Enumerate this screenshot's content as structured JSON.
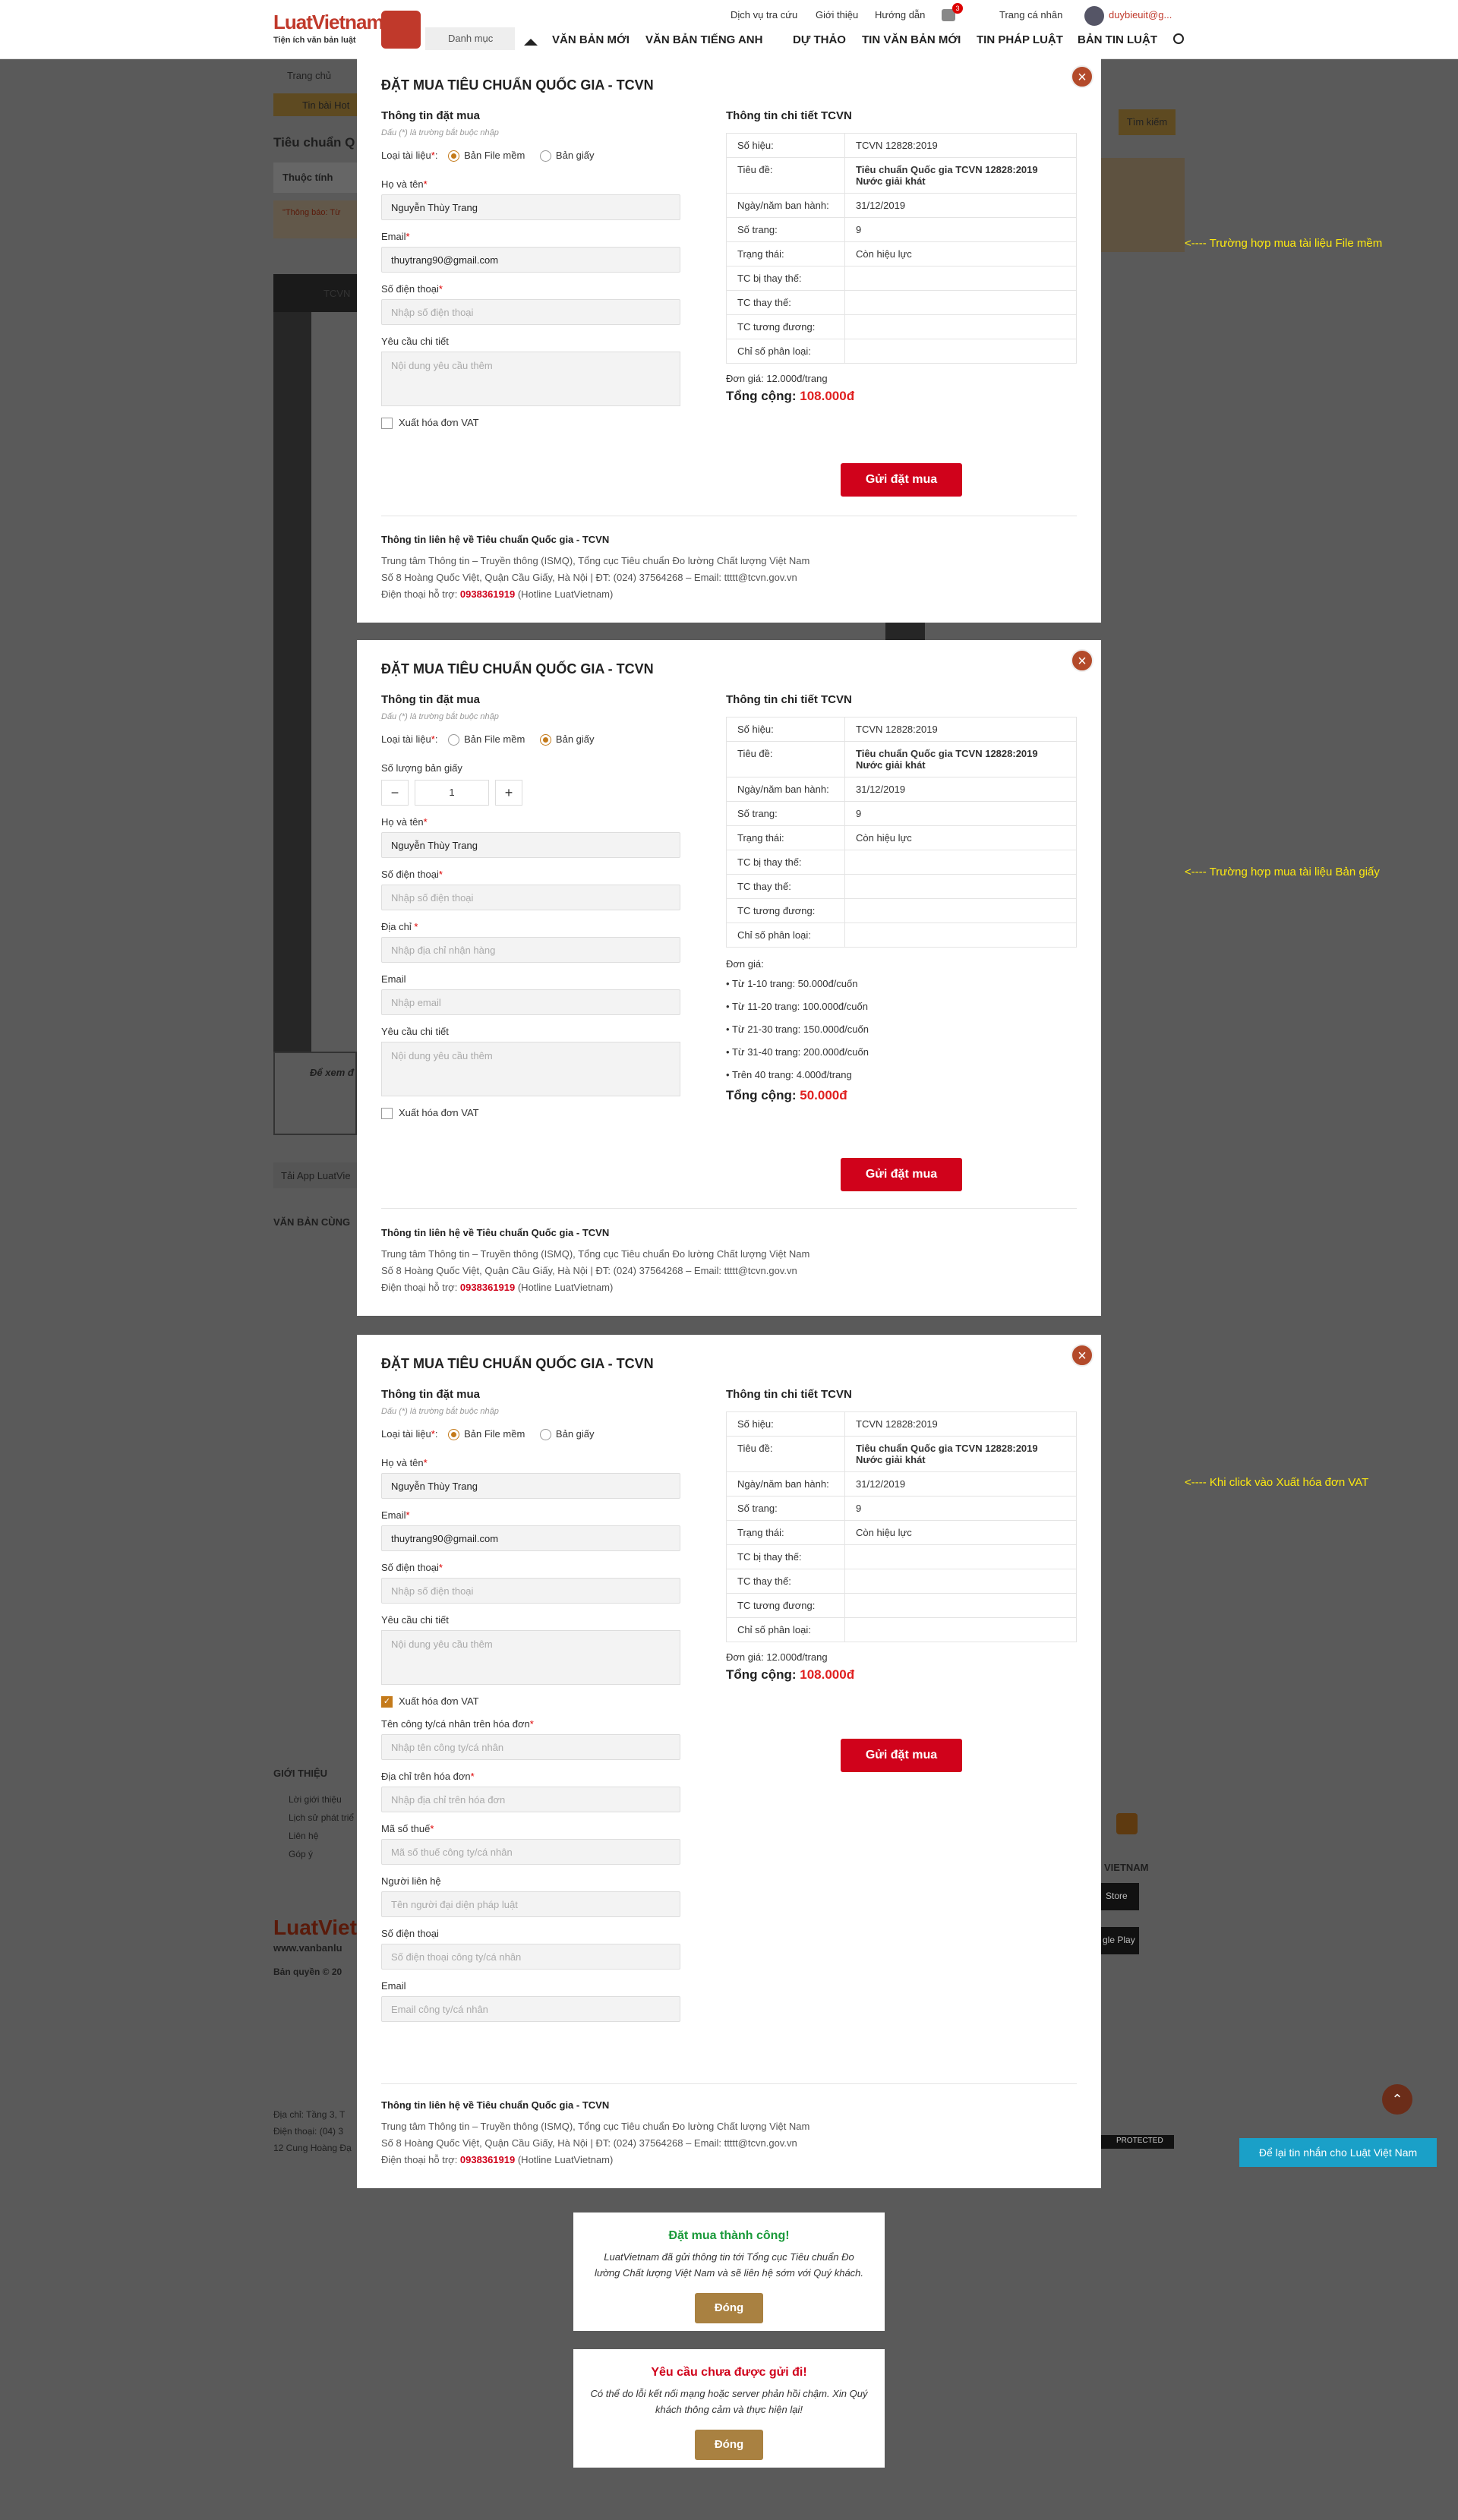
{
  "header": {
    "logo_brand": "LuatVietnam",
    "logo_tagline": "Tiện ích văn bản luật",
    "util_links": [
      "Dịch vụ tra cứu",
      "Giới thiệu",
      "Hướng dẫn",
      "Trang cá nhân",
      "duybieuit@g..."
    ],
    "notif_count": "3",
    "menu_button": "Danh mục",
    "nav": [
      "VĂN BẢN MỚI",
      "VĂN BẢN TIẾNG ANH",
      "DỰ THẢO",
      "TIN VĂN BẢN MỚI",
      "TIN PHÁP LUẬT",
      "BẢN TIN LUẬT"
    ]
  },
  "background": {
    "breadcrumb": "Trang chủ",
    "hot_label": "Tin bài Hot",
    "page_title": "Tiêu chuẩn Q",
    "tab_label": "Thuộc tính",
    "notice": "\"Thông báo: Từ",
    "search_btn": "Tìm kiếm",
    "viewer_code": "TCVN",
    "read_more": "Để xem đ",
    "app_label": "Tải App LuatVie",
    "related_title": "VĂN BẢN CÙNG",
    "intro_title": "GIỚI THIỆU",
    "intro_items": [
      "Lời giới thiệu",
      "Lịch sử phát triể",
      "Liên hệ",
      "Góp ý"
    ],
    "footer_brand": "LuatVietn",
    "footer_web": "www.vanbanlu",
    "copyright": "Bản quyền © 20",
    "address": "Địa chỉ: Tầng 3, T",
    "phone": "Điện thoại: (04) 3",
    "street": "12 Cung Hoàng Đạ",
    "protected": "PROTECTED",
    "app_title": "VIETNAM",
    "store1": "Store",
    "store2": "gle Play"
  },
  "annotations": [
    "<---- Trường hợp mua tài liệu File mềm",
    "<---- Trường hợp mua tài liệu Bản giấy",
    "<---- Khi click vào Xuất hóa đơn VAT"
  ],
  "common": {
    "title": "ĐẶT MUA TIÊU CHUẨN QUỐC GIA - TCVN",
    "left_section": "Thông tin đặt mua",
    "hint": "Dấu (*) là trường bắt buộc nhập",
    "doc_type_label": "Loại tài liệu",
    "opt_soft": "Bản File mềm",
    "opt_paper": "Bản giấy",
    "right_section": "Thông tin chi tiết TCVN",
    "submit": "Gửi đặt mua",
    "vat": "Xuất hóa đơn VAT",
    "contact_title": "Thông tin liên hệ về Tiêu chuẩn Quốc gia - TCVN",
    "contact_line1": "Trung tâm Thông tin – Truyền thông (ISMQ), Tổng cục Tiêu chuẩn Đo lường Chất lượng Việt Nam",
    "contact_line2": "Số 8 Hoàng Quốc Việt, Quận Cầu Giấy, Hà Nội   |   ĐT: (024) 37564268 – Email: ttttt@tcvn.gov.vn",
    "contact_support": "Điện thoại hỗ trợ: ",
    "hotline": "0938361919",
    "hotline_suffix": " (Hotline LuatVietnam)"
  },
  "fields": {
    "name_label": "Họ và tên",
    "name_value": "Nguyễn Thùy Trang",
    "email_label": "Email",
    "email_value": "thuytrang90@gmail.com",
    "email_ph": "Nhập email",
    "phone_label": "Số điện thoại",
    "phone_ph": "Nhập số điện thoại",
    "address_label": "Địa chỉ",
    "address_ph": "Nhập địa chỉ nhận hàng",
    "detail_label": "Yêu cầu chi tiết",
    "detail_ph": "Nội dung yêu cầu thêm",
    "qty_label": "Số lượng bản giấy",
    "qty_value": "1",
    "qty_minus": "−",
    "qty_plus": "+"
  },
  "vat_fields": [
    {
      "label": "Tên công ty/cá nhân trên hóa đơn",
      "req": "*",
      "ph": "Nhập tên công ty/cá nhân"
    },
    {
      "label": "Địa chỉ trên hóa đơn",
      "req": "*",
      "ph": "Nhập địa chỉ trên hóa đơn"
    },
    {
      "label": "Mã số thuế",
      "req": "*",
      "ph": "Mã số thuế công ty/cá nhân"
    },
    {
      "label": "Người liên hệ",
      "req": "",
      "ph": "Tên người đại diện pháp luật"
    },
    {
      "label": "Số điện thoại",
      "req": "",
      "ph": "Số điện thoại công ty/cá nhân"
    },
    {
      "label": "Email",
      "req": "",
      "ph": "Email công ty/cá nhân"
    }
  ],
  "detail": [
    {
      "k": "Số hiệu:",
      "v": "TCVN 12828:2019"
    },
    {
      "k": "Tiêu đề:",
      "v": "Tiêu chuẩn Quốc gia TCVN 12828:2019 Nước giải khát"
    },
    {
      "k": "Ngày/năm ban hành:",
      "v": "31/12/2019"
    },
    {
      "k": "Số trang:",
      "v": "9"
    },
    {
      "k": "Trạng thái:",
      "v": "Còn hiệu lực"
    },
    {
      "k": "TC bị thay thế:",
      "v": ""
    },
    {
      "k": "TC thay thế:",
      "v": ""
    },
    {
      "k": "TC tương đương:",
      "v": ""
    },
    {
      "k": "Chỉ số phân loại:",
      "v": ""
    }
  ],
  "soft_price": {
    "label": "Đơn giá: ",
    "value": "12.000",
    "unit": "đ/trang",
    "total_label": "Tổng cộng: ",
    "total": "108.000đ"
  },
  "paper_price": {
    "label": "Đơn giá:",
    "tiers": [
      "Từ 1-10 trang: 50.000đ/cuốn",
      "Từ 11-20 trang: 100.000đ/cuốn",
      "Từ 21-30 trang: 150.000đ/cuốn",
      "Từ 31-40 trang: 200.000đ/cuốn",
      "Trên 40 trang: 4.000đ/trang"
    ],
    "total_label": "Tổng cộng: ",
    "total": "50.000đ"
  },
  "toast_ok": {
    "title": "Đặt mua thành công!",
    "text": "LuatVietnam đã gửi thông tin tới Tổng cục Tiêu chuẩn Đo lường Chất lượng Việt Nam và sẽ liên hệ sớm với Quý khách.",
    "button": "Đóng",
    "color": "#1a9a3a"
  },
  "toast_err": {
    "title": "Yêu cầu chưa được gửi đi!",
    "text": "Có thể do lỗi kết nối mạng hoặc server phản hồi chậm. Xin Quý khách thông cảm và thực hiện lại!",
    "button": "Đóng",
    "color": "#d0021b"
  },
  "chat": "Để lại tin nhắn cho Luật Việt Nam"
}
